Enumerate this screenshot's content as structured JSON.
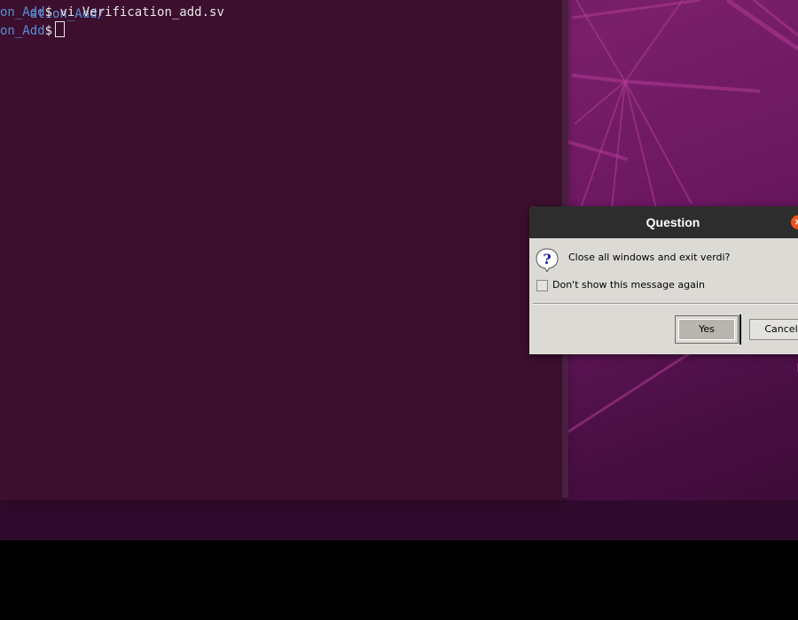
{
  "terminal": {
    "line0_path": "ation_Add/",
    "line1_path": "on_Add",
    "line1_prompt": "$ ",
    "line1_command": "vi Verification_add.sv",
    "line2_path": "on_Add",
    "line2_prompt": "$"
  },
  "dialog": {
    "title": "Question",
    "close_glyph": "×",
    "message": "Close all windows and exit verdi?",
    "checkbox_label": "Don't show this message again",
    "checkbox_checked": false,
    "yes_label": "Yes",
    "cancel_label": "Cancel",
    "icon": "question-icon"
  },
  "colors": {
    "terminal_bg": "#3b0f2d",
    "path_blue": "#5a8fd6",
    "close_orange": "#e95420",
    "titlebar": "#2d2d2d",
    "dialog_bg": "#dcdad5"
  }
}
